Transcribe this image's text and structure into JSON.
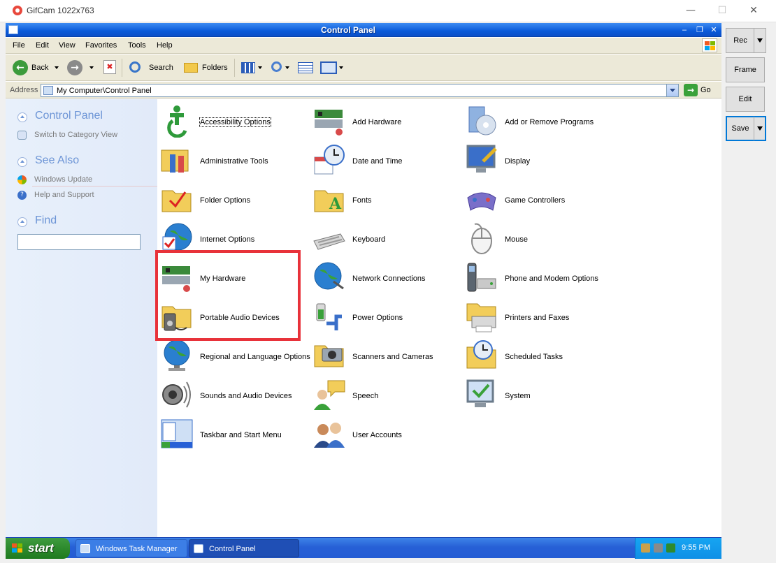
{
  "gifcam": {
    "title": "GifCam 1022x763",
    "buttons": {
      "rec": "Rec",
      "frame": "Frame",
      "edit": "Edit",
      "save": "Save"
    },
    "window_controls": {
      "minimize": "—",
      "maximize": "☐",
      "close": "✕"
    }
  },
  "window": {
    "title": "Control Panel",
    "controls": {
      "minimize": "‒",
      "restore": "❐",
      "close": "✕"
    }
  },
  "menu": [
    "File",
    "Edit",
    "View",
    "Favorites",
    "Tools",
    "Help"
  ],
  "toolbar": {
    "back": "Back",
    "search": "Search",
    "folders": "Folders"
  },
  "address": {
    "label": "Address",
    "value": "My Computer\\Control Panel",
    "go": "Go"
  },
  "task_pane": {
    "control_panel": {
      "title": "Control Panel",
      "link": "Switch to Category View"
    },
    "see_also": {
      "title": "See Also",
      "links": [
        "Windows Update",
        "Help and Support"
      ]
    },
    "find": {
      "title": "Find",
      "value": ""
    }
  },
  "items": [
    "Accessibility Options",
    "Add Hardware",
    "Add or Remove Programs",
    "Administrative Tools",
    "Date and Time",
    "Display",
    "Folder Options",
    "Fonts",
    "Game Controllers",
    "Internet Options",
    "Keyboard",
    "Mouse",
    "My Hardware",
    "Network Connections",
    "Phone and Modem Options",
    "Portable Audio Devices",
    "Power Options",
    "Printers and Faxes",
    "Regional and Language Options",
    "Scanners and Cameras",
    "Scheduled Tasks",
    "Sounds and Audio Devices",
    "Speech",
    "System",
    "Taskbar and Start Menu",
    "User Accounts"
  ],
  "taskbar": {
    "start": "start",
    "tasks": [
      "Windows Task Manager",
      "Control Panel"
    ],
    "clock": "9:55 PM"
  }
}
